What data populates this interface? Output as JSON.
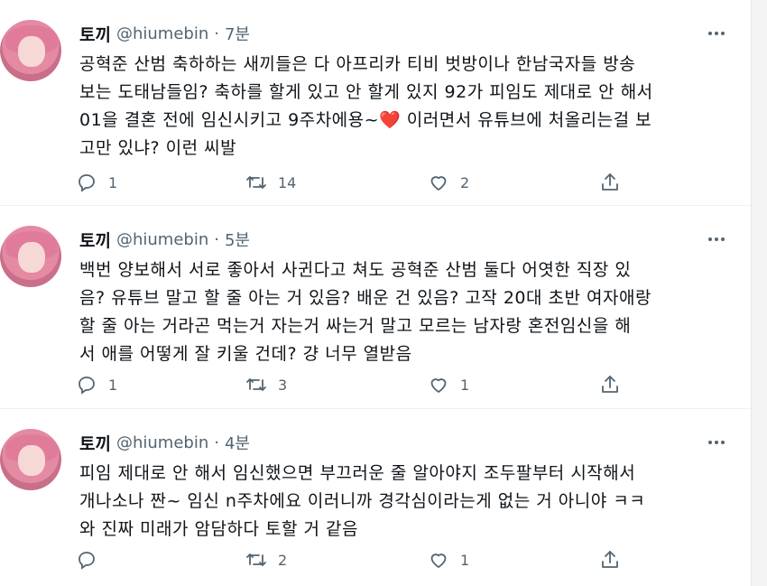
{
  "tweets": [
    {
      "name": "토끼",
      "handle": "@hiumebin",
      "time": "7분",
      "lines": [
        "공혁준 산범 축하하는 새끼들은 다 아프리카 티비 벗방이나 한남국자들 방송",
        "보는 도태남들임? 축하를 할게 있고 안 할게 있지 92가 피임도 제대로 안 해서",
        "01을 결혼 전에 임신시키고 9주차에용~",
        "고만 있냐? 이런 씨발"
      ],
      "line3_after_heart": " 이러면서 유튜브에 처올리는걸 보",
      "heart_glyph": "❤️",
      "replies": "1",
      "retweets": "14",
      "likes": "2"
    },
    {
      "name": "토끼",
      "handle": "@hiumebin",
      "time": "5분",
      "lines": [
        "백번 양보해서 서로 좋아서 사귄다고 쳐도 공혁준 산범 둘다 어엿한 직장 있",
        "음? 유튜브 말고 할 줄 아는 거 있음? 배운 건 있음? 고작 20대 초반 여자애랑",
        "할 줄 아는 거라곤 먹는거 자는거 싸는거 말고 모르는 남자랑 혼전임신을 해",
        "서 애를 어떻게 잘 키울 건데? 걍 너무 열받음"
      ],
      "replies": "1",
      "retweets": "3",
      "likes": "1"
    },
    {
      "name": "토끼",
      "handle": "@hiumebin",
      "time": "4분",
      "lines": [
        "피임 제대로 안 해서 임신했으면 부끄러운 줄 알아야지 조두팔부터 시작해서",
        "개나소나 짠~ 임신 n주차에요 이러니까 경각심이라는게 없는 거 아니야 ㅋㅋ",
        "와 진짜 미래가 암담하다 토할 거 같음"
      ],
      "replies": "",
      "retweets": "2",
      "likes": "1"
    }
  ],
  "separator": "·",
  "icons": {
    "reply": "reply-icon",
    "retweet": "retweet-icon",
    "like": "heart-icon",
    "share": "share-icon",
    "more": "more-icon"
  },
  "colors": {
    "text": "#0f1419",
    "secondary": "#536471",
    "heart": "#e0245e",
    "border": "#eff3f4"
  }
}
